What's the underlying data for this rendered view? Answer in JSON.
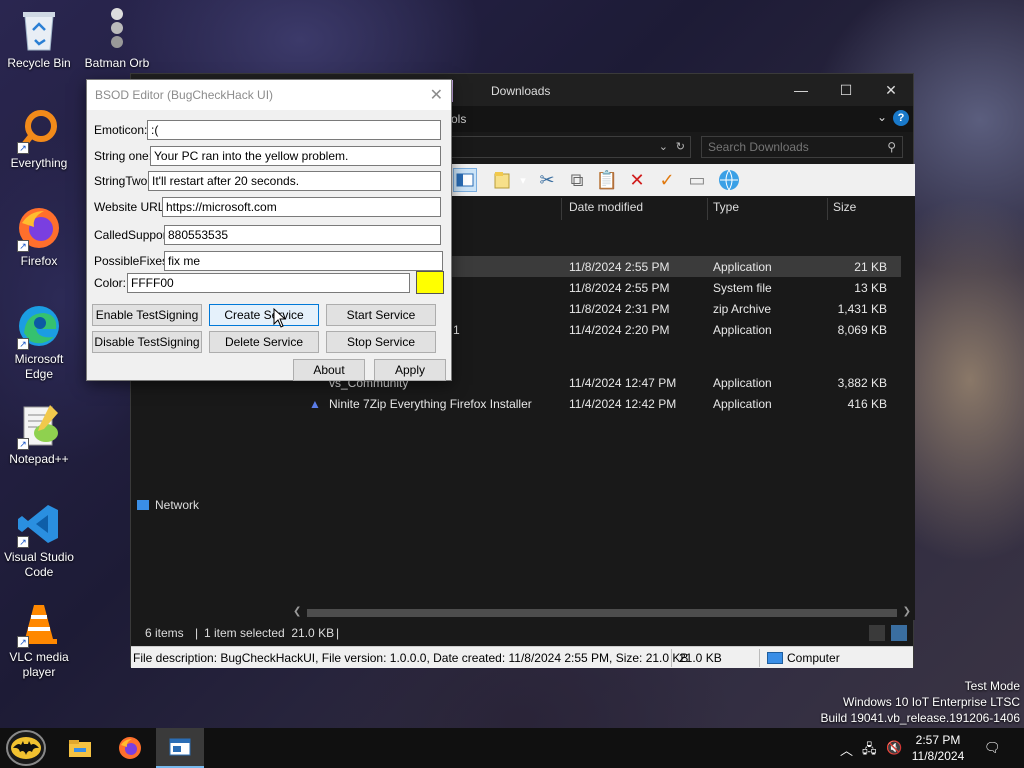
{
  "desktop": {
    "icons": [
      {
        "label": "Recycle Bin",
        "icon": "recycle-bin-icon"
      },
      {
        "label": "Batman Orb",
        "icon": "batman-orb-icon"
      },
      {
        "label": "Everything",
        "icon": "everything-search-icon"
      },
      {
        "label": "Firefox",
        "icon": "firefox-icon"
      },
      {
        "label": "Microsoft Edge",
        "icon": "edge-icon"
      },
      {
        "label": "Notepad++",
        "icon": "notepadpp-icon"
      },
      {
        "label": "Visual Studio Code",
        "icon": "vscode-icon"
      },
      {
        "label": "VLC media player",
        "icon": "vlc-icon"
      }
    ]
  },
  "explorer": {
    "title": "Downloads",
    "ribbon_partial": "ols",
    "search_placeholder": "Search Downloads",
    "columns": [
      "Date modified",
      "Type",
      "Size"
    ],
    "rows": [
      {
        "name": "",
        "date": "11/8/2024 2:55 PM",
        "type": "Application",
        "size": "21 KB",
        "selected": true
      },
      {
        "name": "",
        "date": "11/8/2024 2:55 PM",
        "type": "System file",
        "size": "13 KB"
      },
      {
        "name": "",
        "date": "11/8/2024 2:31 PM",
        "type": "zip Archive",
        "size": "1,431 KB"
      },
      {
        "name": "1",
        "date": "11/4/2024 2:20 PM",
        "type": "Application",
        "size": "8,069 KB"
      },
      {
        "name": "vs_Community",
        "date": "11/4/2024 12:47 PM",
        "type": "Application",
        "size": "3,882 KB"
      },
      {
        "name": "Ninite 7Zip Everything Firefox Installer",
        "date": "11/4/2024 12:42 PM",
        "type": "Application",
        "size": "416 KB"
      }
    ],
    "nav_network": "Network",
    "status": {
      "items": "6 items",
      "selected": "1 item selected  21.0 KB",
      "pipe": "|"
    },
    "description_bar": {
      "text": "File description: BugCheckHackUI, File version: 1.0.0.0, Date created: 11/8/2024 2:55 PM, Size: 21.0 KB",
      "size": "21.0 KB",
      "location": "Computer"
    }
  },
  "dialog": {
    "title": "BSOD Editor (BugCheckHack UI)",
    "fields": {
      "emoticon_label": "Emoticon:",
      "emoticon_value": ":(",
      "string_one_label": "String one:",
      "string_one_value": "Your PC ran into the yellow problem.",
      "string_two_label": "StringTwo:",
      "string_two_value": "It'll restart after 20 seconds.",
      "website_label": "Website URL:",
      "website_value": "https://microsoft.com",
      "called_support_label": "CalledSupport:",
      "called_support_value": "880553535",
      "possible_fixes_label": "PossibleFixes:",
      "possible_fixes_value": "fix me",
      "color_label": "Color:",
      "color_value": "FFFF00"
    },
    "swatch_color": "#ffff00",
    "buttons": {
      "enable_testsigning": "Enable TestSigning",
      "create_service": "Create Service",
      "start_service": "Start Service",
      "disable_testsigning": "Disable TestSigning",
      "delete_service": "Delete Service",
      "stop_service": "Stop Service",
      "about": "About",
      "apply": "Apply"
    }
  },
  "watermark": {
    "line1": "Test Mode",
    "line2": "Windows 10 IoT Enterprise LTSC",
    "line3": "Build 19041.vb_release.191206-1406"
  },
  "taskbar": {
    "time": "2:57 PM",
    "date": "11/8/2024",
    "pinned": [
      "batman-start-icon",
      "file-explorer-icon",
      "firefox-icon",
      "bsod-editor-icon"
    ]
  }
}
